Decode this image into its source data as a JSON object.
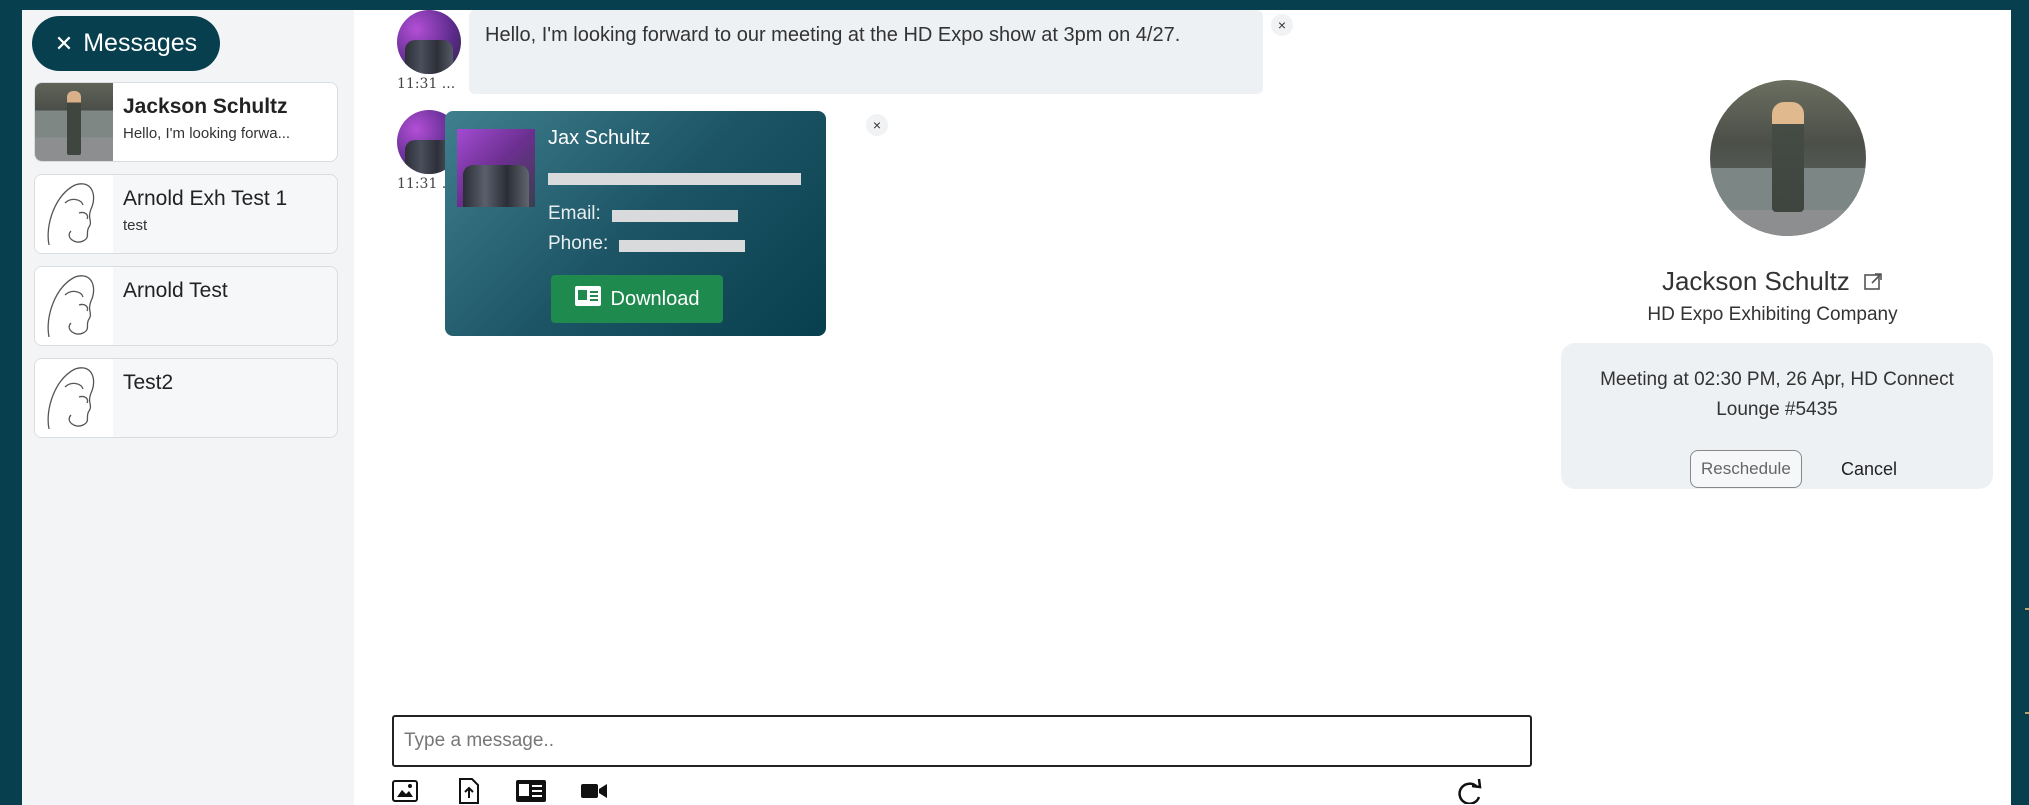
{
  "sidebar": {
    "header_label": "Messages",
    "conversations": [
      {
        "name": "Jackson Schultz",
        "preview": "Hello, I'm looking forwa...",
        "active": true
      },
      {
        "name": "Arnold Exh Test 1",
        "preview": "test",
        "active": false
      },
      {
        "name": "Arnold Test",
        "preview": "",
        "active": false
      },
      {
        "name": "Test2",
        "preview": "",
        "active": false
      }
    ]
  },
  "chat": {
    "messages": [
      {
        "time": "11:31 ...",
        "text": "Hello, I'm looking forward to our meeting at the HD Expo show at 3pm on 4/27."
      },
      {
        "time": "11:31 ...",
        "card": {
          "name": "Jax Schultz",
          "email_label": "Email:",
          "phone_label": "Phone:",
          "button_label": "Download"
        }
      }
    ],
    "composer_placeholder": "Type a message..",
    "close_glyph": "×"
  },
  "profile": {
    "name": "Jackson Schultz",
    "company": "HD Expo Exhibiting Company",
    "meeting_text": "Meeting at 02:30 PM, 26 Apr, HD Connect Lounge #5435",
    "reschedule_label": "Reschedule",
    "cancel_label": "Cancel"
  },
  "colors": {
    "brand": "#073f4e",
    "download_green": "#1e8a4d"
  }
}
